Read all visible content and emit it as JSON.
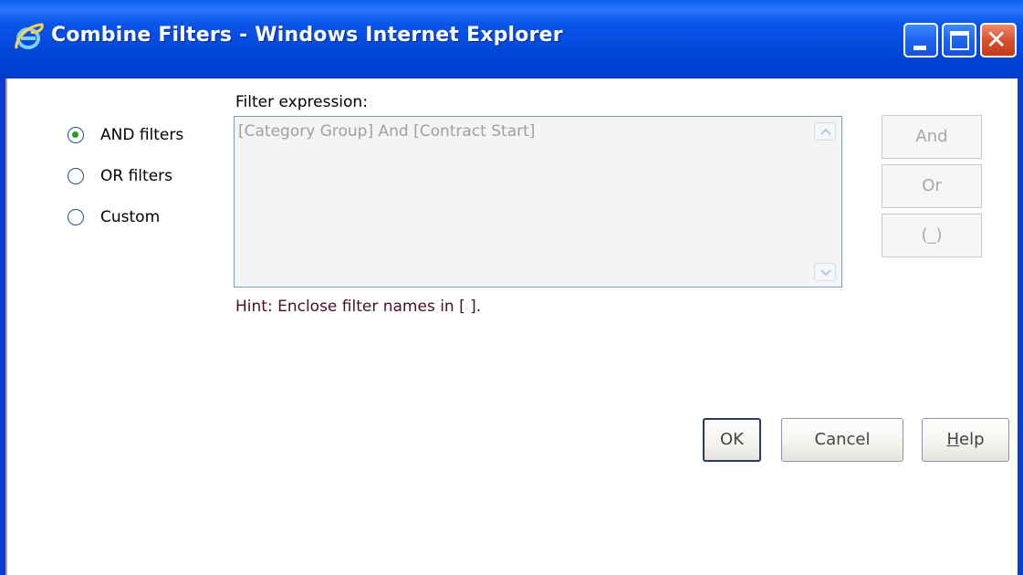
{
  "window": {
    "title": "Combine Filters - Windows Internet Explorer",
    "icons": {
      "app": "ie-icon",
      "minimize": "minimize-icon",
      "maximize": "maximize-icon",
      "close": "close-icon"
    }
  },
  "filter": {
    "label": "Filter expression:",
    "expression": "[Category Group] And [Contract Start]",
    "hint": "Hint: Enclose filter names in [ ]."
  },
  "radios": [
    {
      "label": "AND filters",
      "checked": true
    },
    {
      "label": "OR filters",
      "checked": false
    },
    {
      "label": "Custom",
      "checked": false
    }
  ],
  "operators": {
    "and": "And",
    "or": "Or",
    "parens": "(_)"
  },
  "buttons": {
    "ok": "OK",
    "cancel": "Cancel",
    "help_first": "H",
    "help_rest": "elp"
  },
  "colors": {
    "titlebar": "#0045d8",
    "radio_checked": "#22a022",
    "hint_text": "#4a0e2a",
    "disabled_text": "#a8a8a8"
  }
}
